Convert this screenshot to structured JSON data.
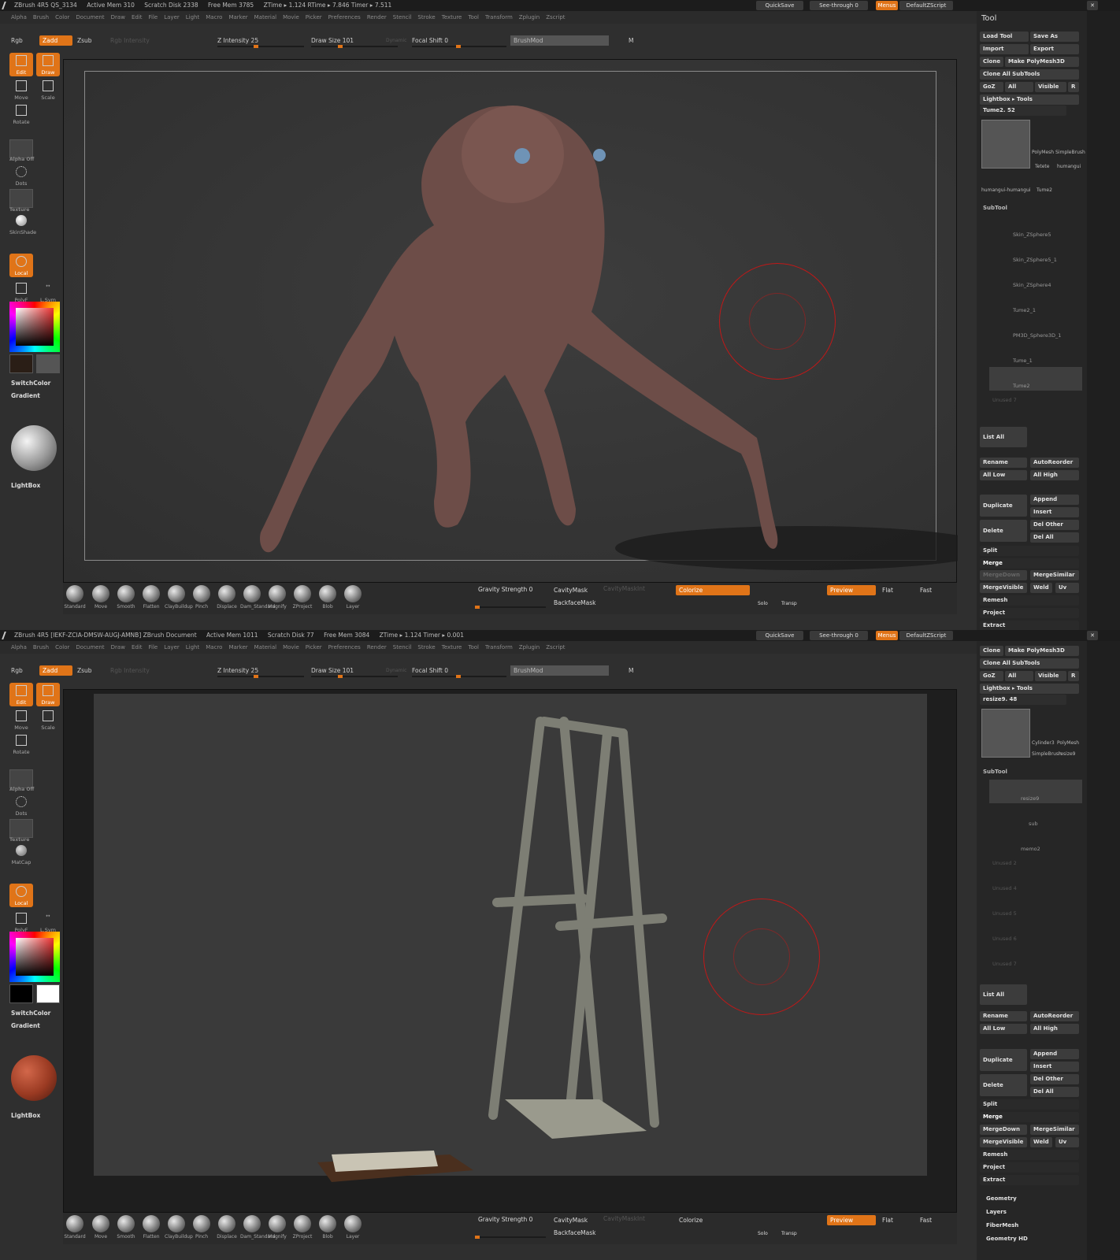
{
  "panel1": {
    "title": "ZBrush 4R5   QS_3134",
    "stats": [
      "Active Mem 310",
      "Scratch Disk 2338",
      "Free Mem 3785",
      "ZTime ▸ 1.124 RTime ▸ 7.846 Timer ▸ 7.511"
    ],
    "quicksave": "QuickSave",
    "seethrough": "See-through  0",
    "menus_btn": "Menus",
    "script": "DefaultZScript",
    "tool_panel": {
      "header": "Tool",
      "buttons": [
        "Load Tool",
        "Save As",
        "Import",
        "Export",
        "Clone",
        "Make PolyMesh3D",
        "Clone  All  SubTools",
        "GoZ",
        "All",
        "Visible",
        "R",
        "Lightbox ▸ Tools"
      ],
      "current_tool": "Tume2. 52",
      "tool_thumbs": [
        "PolyMesh",
        "SimpleBrush",
        "Tetete",
        "humangui",
        "humangui-humangui",
        "Tume2"
      ],
      "subtool_header": "SubTool",
      "subtools": [
        "Skin_ZSphere5",
        "Skin_ZSphere5_1",
        "Skin_ZSphere4",
        "Tume2_1",
        "PM3D_Sphere3D_1",
        "Tume_1",
        "Tume2",
        "Unused 7"
      ],
      "actions": [
        "List  All",
        "Rename",
        "AutoReorder",
        "All  Low",
        "All  High",
        "Duplicate",
        "Append",
        "Insert",
        "Delete",
        "Del  Other",
        "Del  All",
        "Split",
        "Merge",
        "MergeDown",
        "MergeSimilar",
        "MergeVisible",
        "Weld",
        "Uv",
        "Remesh",
        "Project",
        "Extract"
      ]
    }
  },
  "panel2": {
    "title": "ZBrush 4R5 [IEKF-ZCIA-DMSW-AUGJ-AMNB]   ZBrush Document",
    "stats": [
      "Active Mem 1011",
      "Scratch Disk 77",
      "Free Mem 3084",
      "ZTime ▸ 1.124 Timer ▸ 0.001"
    ],
    "quicksave": "QuickSave",
    "seethrough": "See-through  0",
    "menus_btn": "Menus",
    "script": "DefaultZScript",
    "tool_panel": {
      "buttons": [
        "Clone",
        "Make PolyMesh3D",
        "Clone  All  SubTools",
        "GoZ",
        "All",
        "Visible",
        "R",
        "Lightbox ▸ Tools"
      ],
      "current_tool": "resize9. 48",
      "tool_thumbs": [
        "Cylinder3",
        "PolyMesh",
        "SimpleBrush",
        "resize9"
      ],
      "subtool_header": "SubTool",
      "subtools": [
        "resize9",
        "sub",
        "memo2",
        "Unused 2",
        "Unused 4",
        "Unused 5",
        "Unused 6",
        "Unused 7"
      ],
      "actions": [
        "List  All",
        "Rename",
        "AutoReorder",
        "All  Low",
        "All  High",
        "Duplicate",
        "Append",
        "Insert",
        "Delete",
        "Del  Other",
        "Del  All",
        "Split",
        "Merge",
        "MergeDown",
        "MergeSimilar",
        "MergeVisible",
        "Weld",
        "Uv",
        "Remesh",
        "Project",
        "Extract"
      ],
      "extra": [
        "Geometry",
        "Layers",
        "FiberMesh",
        "Geometry HD"
      ]
    }
  },
  "menus": [
    "Alpha",
    "Brush",
    "Color",
    "Document",
    "Draw",
    "Edit",
    "File",
    "Layer",
    "Light",
    "Macro",
    "Marker",
    "Material",
    "Movie",
    "Picker",
    "Preferences",
    "Render",
    "Stencil",
    "Stroke",
    "Texture",
    "Tool",
    "Transform",
    "Zplugin",
    "Zscript"
  ],
  "topbar": {
    "rgb": "Rgb",
    "zadd": "Zadd",
    "zsub": "Zsub",
    "rgb_intensity": "Rgb  Intensity",
    "z_intensity": "Z  Intensity 25",
    "draw_size": "Draw  Size 101",
    "dynamic": "Dynamic",
    "focal_shift": "Focal  Shift 0",
    "brushmod": "BrushMod",
    "m": "M"
  },
  "leftbar": {
    "edit": "Edit",
    "draw": "Draw",
    "move": "Move",
    "scale": "Scale",
    "rotate": "Rotate",
    "alpha": "Alpha  Off",
    "dots": "Dots",
    "texture": "Texture",
    "material1": "SkinShade",
    "material2": "MatCap",
    "local": "Local",
    "polyf": "PolyF",
    "lsym": "L.Sym",
    "switchcolor": "SwitchColor",
    "gradient": "Gradient",
    "lightbox": "LightBox"
  },
  "brushes": [
    "Standard",
    "Move",
    "Smooth",
    "Flatten",
    "ClayBuildup",
    "Pinch",
    "Displace",
    "Dam_Standard",
    "Magnify",
    "ZProject",
    "Blob",
    "Layer"
  ],
  "bottom": {
    "gravity": "Gravity  Strength 0",
    "cavity": "CavityMask",
    "cavity_int": "CavityMaskInt",
    "backface": "BackfaceMask",
    "colorize": "Colorize",
    "solo": "Solo",
    "transp": "Transp",
    "preview": "Preview",
    "flat": "Flat",
    "fast": "Fast"
  },
  "colors": {
    "accent": "#e07418",
    "bg": "#2f2f2f",
    "viewport": "#373737",
    "cursor": "#c01818"
  }
}
